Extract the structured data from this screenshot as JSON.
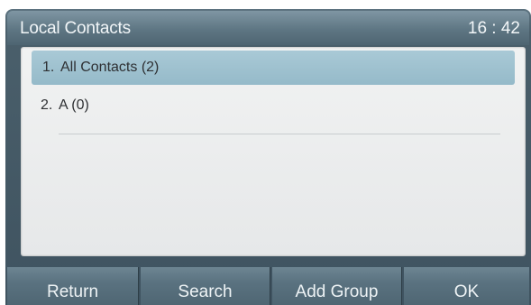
{
  "titlebar": {
    "title": "Local Contacts",
    "clock": "16 : 42"
  },
  "list": {
    "items": [
      {
        "number": "1.",
        "label": "All Contacts (2)",
        "selected": true
      },
      {
        "number": "2.",
        "label": "A (0)",
        "selected": false
      }
    ]
  },
  "softkeys": {
    "return_label": "Return",
    "search_label": "Search",
    "add_group_label": "Add Group",
    "ok_label": "OK"
  },
  "colors": {
    "titlebar": "#5e7683",
    "selected_row": "#a9c9d6",
    "softkey": "#5a7280",
    "content_bg": "#eceeef"
  }
}
